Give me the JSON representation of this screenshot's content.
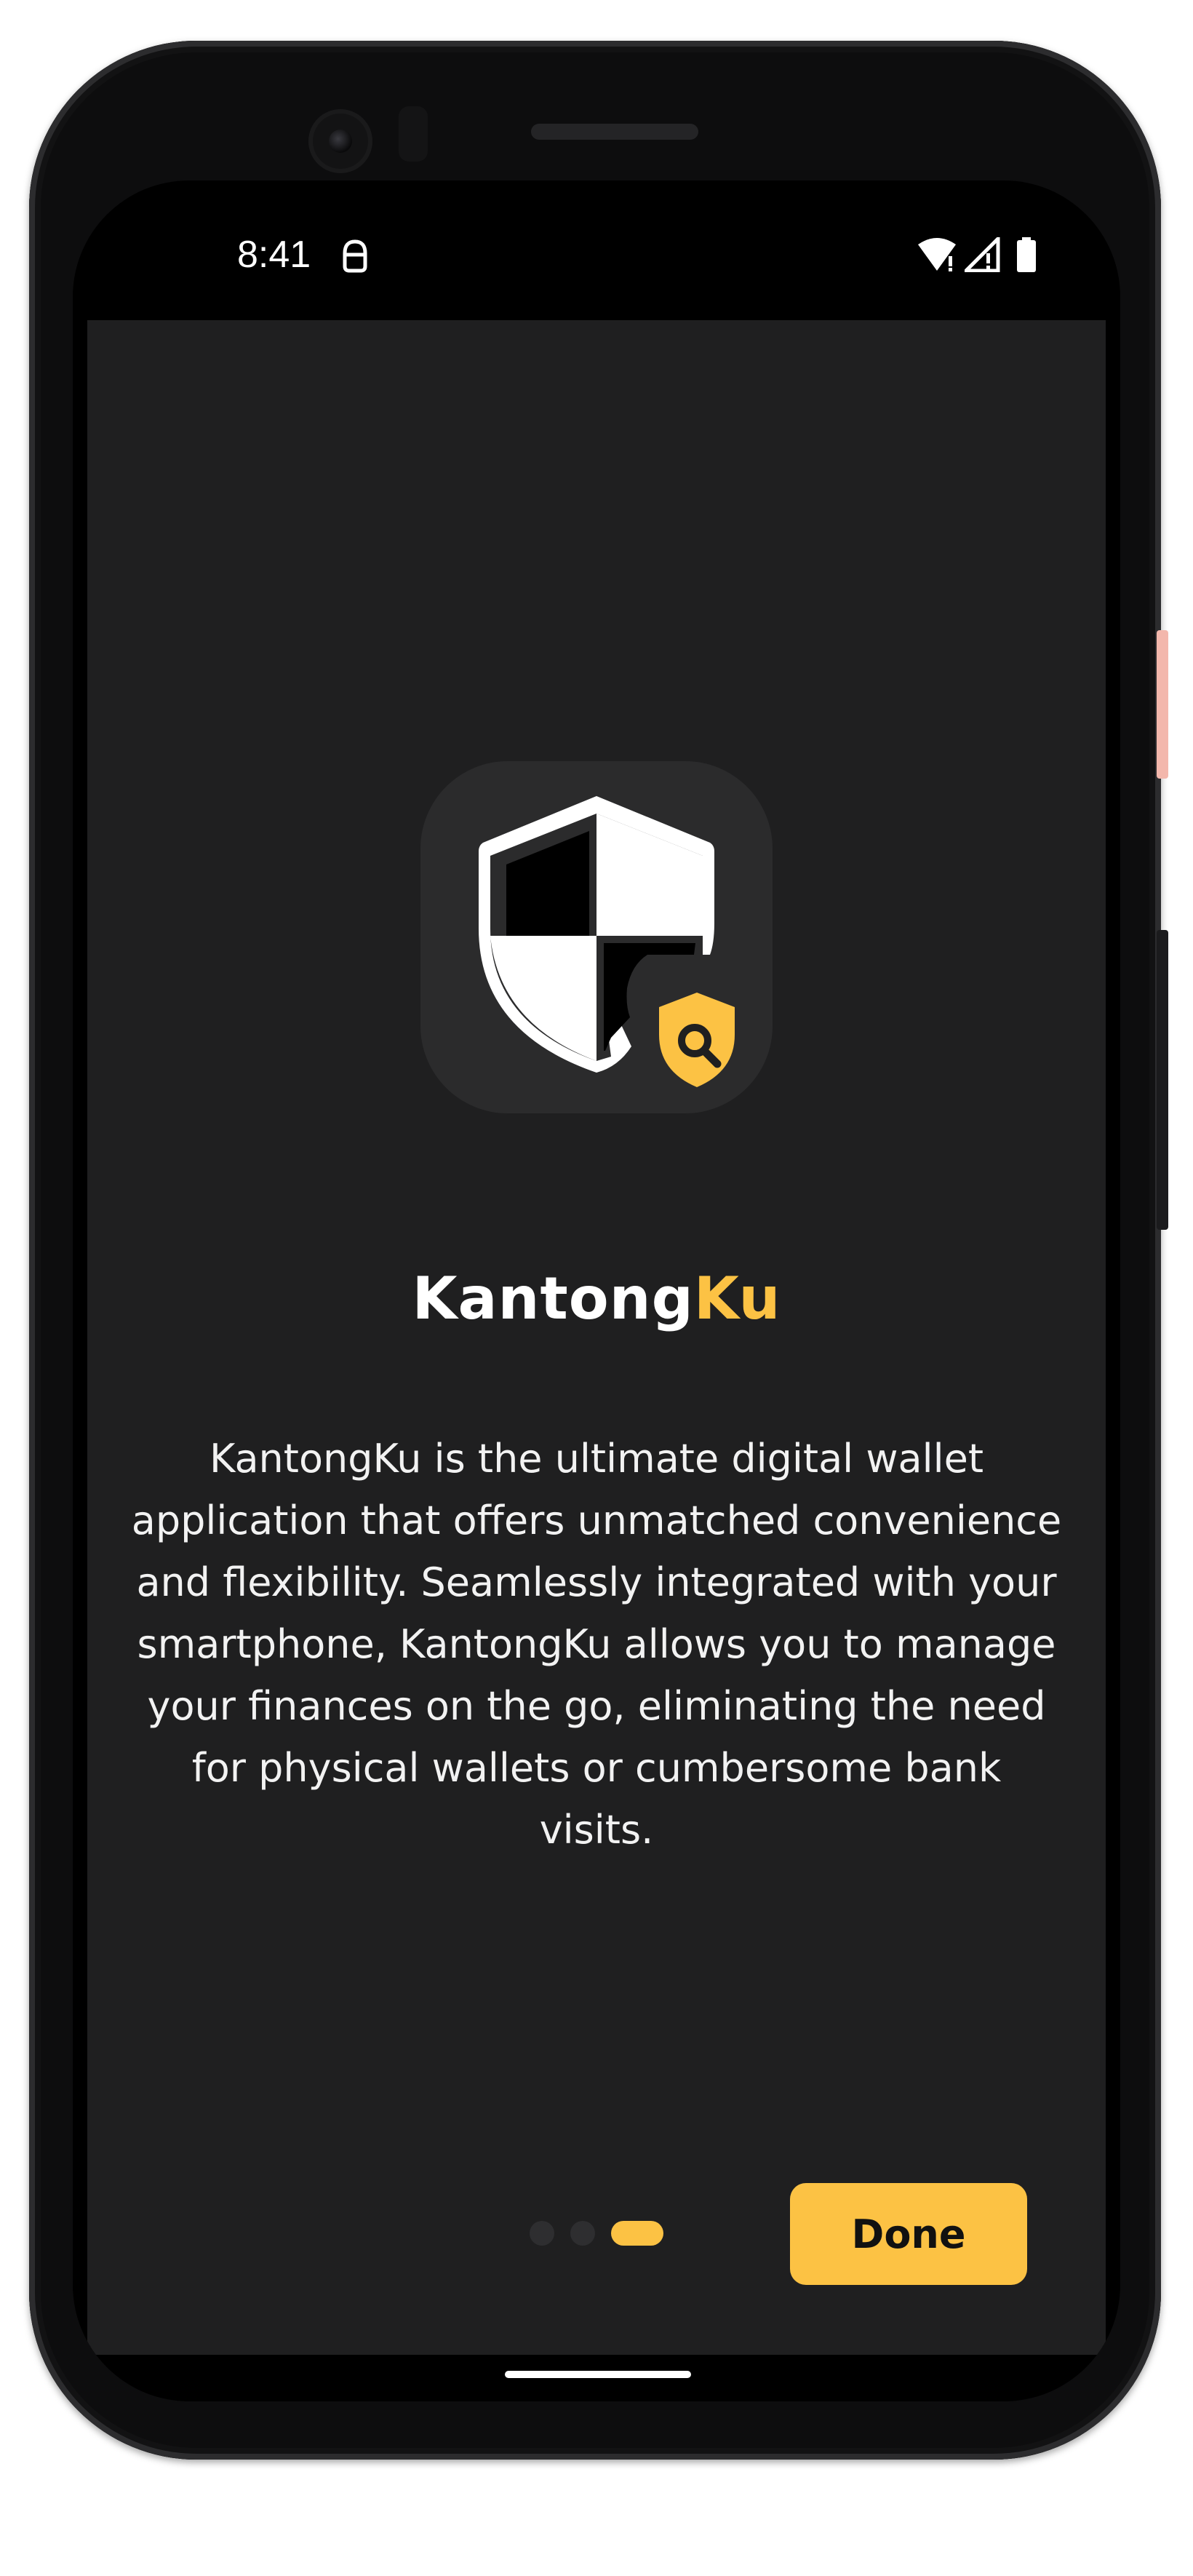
{
  "status_bar": {
    "time": "8:41",
    "icons": [
      "notification-icon",
      "wifi-icon",
      "signal-icon",
      "battery-icon"
    ]
  },
  "onboarding": {
    "logo_icon": "shield-search-icon",
    "brand_part1": "Kantong",
    "brand_part2": "Ku",
    "description": "KantongKu is the ultimate digital wallet application that offers unmatched convenience and flexibility. Seamlessly integrated with your smartphone, KantongKu allows you to manage your finances on the go, eliminating the need for physical wallets or cumbersome bank visits.",
    "pages_total": 3,
    "current_page": 3,
    "done_label": "Done"
  },
  "colors": {
    "accent": "#fcc244",
    "background": "#1f1f20",
    "tile": "#2b2b2c",
    "text": "#ffffff"
  }
}
